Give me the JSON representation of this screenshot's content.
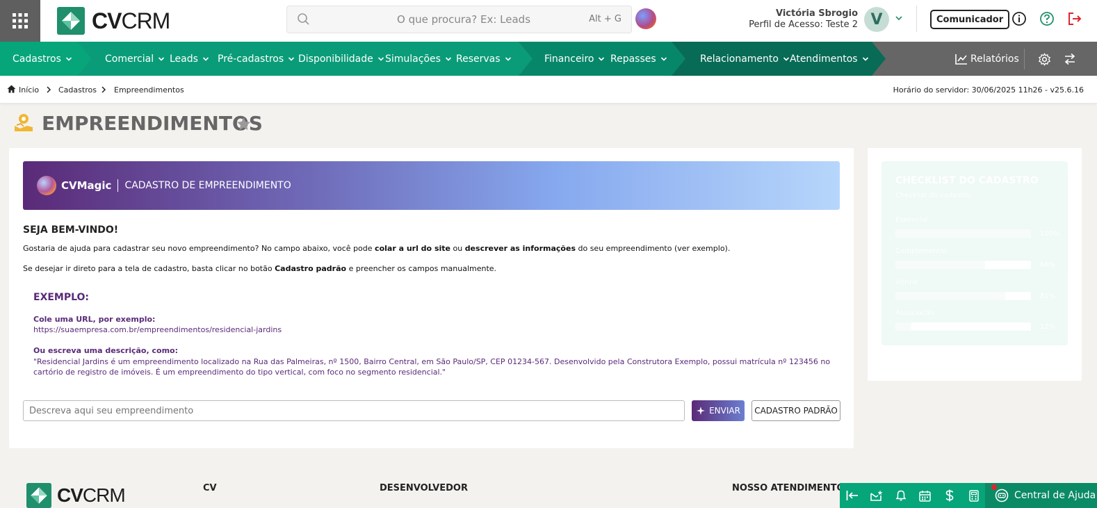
{
  "brand": {
    "logo_bold": "CV",
    "logo_light": "CRM"
  },
  "search": {
    "placeholder": "O que procura? Ex: Leads",
    "shortcut": "Alt + G"
  },
  "user": {
    "name": "Victória Sbrogio",
    "profile": "Perfil de Acesso: Teste 2",
    "initial": "V"
  },
  "top_buttons": {
    "communicator": "Comunicador"
  },
  "nav": {
    "groups": [
      {
        "color": "#06a57a",
        "items": [
          "Cadastros"
        ]
      },
      {
        "color": "#0a9c78",
        "items": [
          "Comercial",
          "Leads",
          "Pré-cadastros",
          "Disponibilidade",
          "Simulações",
          "Reservas"
        ]
      },
      {
        "color": "#07876a",
        "items": [
          "Financeiro",
          "Repasses"
        ]
      },
      {
        "color": "#086b56",
        "items": [
          "Relacionamento",
          "Atendimentos"
        ]
      }
    ],
    "reports": "Relatórios"
  },
  "breadcrumb": {
    "home": "Início",
    "level1": "Cadastros",
    "level2": "Empreendimentos"
  },
  "server_time": "Horário do servidor: 30/06/2025 11h26 - v25.6.16",
  "page_title": "EMPREENDIMENTOS",
  "banner": {
    "brand": "CVMagic",
    "title": "CADASTRO DE EMPREENDIMENTO"
  },
  "welcome": {
    "heading": "SEJA BEM-VINDO!",
    "p1_a": "Gostaria de ajuda para cadastrar seu novo empreendimento? No campo abaixo, você pode ",
    "p1_b": "colar a url do site",
    "p1_c": " ou ",
    "p1_d": "descrever as informações",
    "p1_e": " do seu empreendimento (ver exemplo).",
    "p2_a": "Se desejar ir direto para a tela de cadastro, basta clicar no botão ",
    "p2_b": "Cadastro padrão",
    "p2_c": " e preencher os campos manualmente."
  },
  "example": {
    "heading": "EXEMPLO:",
    "url_label": "Cole uma URL, por exemplo:",
    "url_value": "https://suaempresa.com.br/empreendimentos/residencial-jardins",
    "desc_label": "Ou escreva uma descrição, como:",
    "desc_value": "\"Residencial Jardins é um empreendimento localizado na Rua das Palmeiras, nº 1500, Bairro Central, em São Paulo/SP, CEP 01234-567. Desenvolvido pela Construtora Exemplo, possui matrícula nº 123456 no cartório de registro de imóveis. É um empreendimento do tipo vertical, com foco no segmento residencial.\""
  },
  "form": {
    "input_placeholder": "Descreva aqui seu empreendimento",
    "send_label": "ENVIAR",
    "standard_label": "CADASTRO PADRÃO"
  },
  "checklist": {
    "title": "CHECKLIST DO CADASTRO",
    "subtitle": "Checklist do cadastro",
    "items": [
      {
        "label": "Essencial",
        "pct_text": "100%",
        "value": 1.0
      },
      {
        "label": "Complementar",
        "pct_text": "66%",
        "value": 0.66
      },
      {
        "label": "Vitrine",
        "pct_text": "81%",
        "value": 0.81
      },
      {
        "label": "Associação",
        "pct_text": "12%",
        "value": 0.12
      }
    ]
  },
  "footer": {
    "col1": "CV",
    "col2": "DESENVOLVEDOR",
    "col3": "NOSSO ATENDIMENTO",
    "help": "Central de Ajuda"
  },
  "colors": {
    "brand_green": "#06a57a",
    "purple": "#5a2a78",
    "logout_red": "#e0242d"
  }
}
